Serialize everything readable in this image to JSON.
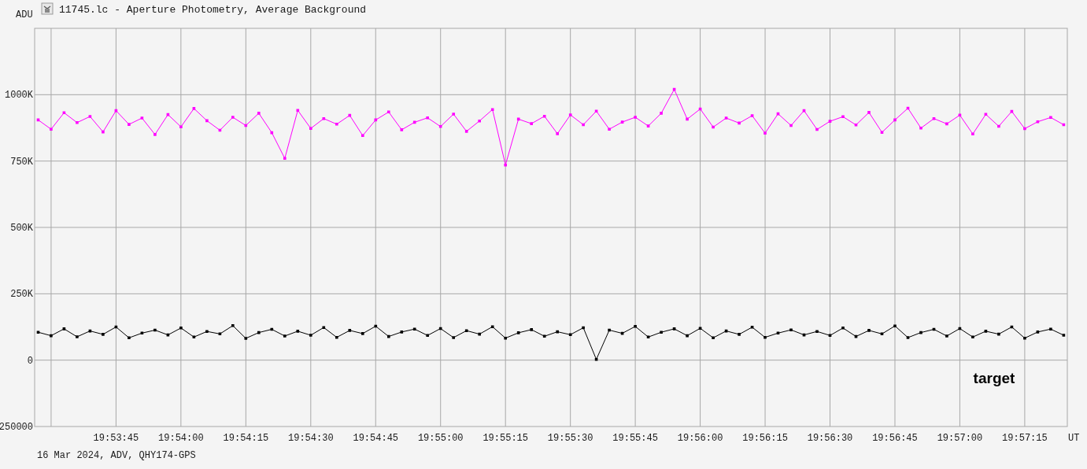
{
  "window": {
    "title": "11745.lc - Aperture Photometry, Average Background"
  },
  "plot": {
    "chart_data": {
      "type": "line",
      "ylabel": "ADU",
      "xlabel": "UT",
      "categories": [
        null,
        null,
        null,
        null,
        null,
        null,
        "19:53:45",
        null,
        null,
        null,
        null,
        "19:54:00",
        null,
        null,
        null,
        null,
        "19:54:15",
        null,
        null,
        null,
        null,
        "19:54:30",
        null,
        null,
        null,
        null,
        "19:54:45",
        null,
        null,
        null,
        null,
        "19:55:00",
        null,
        null,
        null,
        null,
        "19:55:15",
        null,
        null,
        null,
        null,
        "19:55:30",
        null,
        null,
        null,
        null,
        "19:55:45",
        null,
        null,
        null,
        null,
        "19:56:00",
        null,
        null,
        null,
        null,
        "19:56:15",
        null,
        null,
        null,
        null,
        "19:56:30",
        null,
        null,
        null,
        null,
        "19:56:45",
        null,
        null,
        null,
        null,
        "19:57:00",
        null,
        null,
        null,
        null,
        "19:57:15",
        null,
        null,
        null
      ],
      "ylim": [
        -250000,
        1250000
      ],
      "grid": true,
      "yticks": [
        {
          "value": 1000000,
          "label": "1000K"
        },
        {
          "value": 750000,
          "label": "750K"
        },
        {
          "value": 500000,
          "label": "500K"
        },
        {
          "value": 250000,
          "label": "250K"
        },
        {
          "value": 0,
          "label": "0"
        },
        {
          "value": -250000,
          "label": "250000"
        }
      ],
      "series": [
        {
          "color": "#ff00ff",
          "marker": "square",
          "values": [
            905000,
            870000,
            932000,
            895000,
            918000,
            860000,
            940000,
            888000,
            912000,
            850000,
            925000,
            879000,
            948000,
            902000,
            866000,
            915000,
            884000,
            930000,
            857000,
            760000,
            941000,
            873000,
            910000,
            889000,
            922000,
            846000,
            905000,
            935000,
            868000,
            896000,
            913000,
            880000,
            927000,
            862000,
            901000,
            944000,
            735000,
            908000,
            891000,
            919000,
            853000,
            924000,
            887000,
            938000,
            870000,
            897000,
            915000,
            882000,
            930000,
            1020000,
            908000,
            946000,
            878000,
            912000,
            893000,
            921000,
            855000,
            928000,
            884000,
            940000,
            869000,
            900000,
            917000,
            886000,
            933000,
            858000,
            905000,
            949000,
            874000,
            910000,
            890000,
            923000,
            852000,
            926000,
            881000,
            937000,
            872000,
            898000,
            914000,
            887000
          ]
        },
        {
          "name": "target",
          "color": "#000000",
          "marker": "square",
          "values": [
            105000,
            92000,
            118000,
            88000,
            110000,
            97000,
            125000,
            84000,
            102000,
            113000,
            95000,
            121000,
            87000,
            108000,
            99000,
            130000,
            82000,
            104000,
            116000,
            91000,
            109000,
            94000,
            123000,
            86000,
            112000,
            100000,
            128000,
            89000,
            106000,
            117000,
            93000,
            119000,
            85000,
            111000,
            98000,
            126000,
            83000,
            103000,
            115000,
            90000,
            107000,
            96000,
            122000,
            3000,
            113000,
            101000,
            127000,
            87000,
            105000,
            118000,
            92000,
            120000,
            84000,
            110000,
            97000,
            124000,
            86000,
            102000,
            114000,
            95000,
            108000,
            93000,
            121000,
            89000,
            112000,
            99000,
            129000,
            85000,
            104000,
            116000,
            91000,
            119000,
            87000,
            109000,
            98000,
            125000,
            83000,
            106000,
            117000,
            94000
          ]
        }
      ]
    }
  },
  "footer": "16 Mar 2024, ADV, QHY174-GPS"
}
